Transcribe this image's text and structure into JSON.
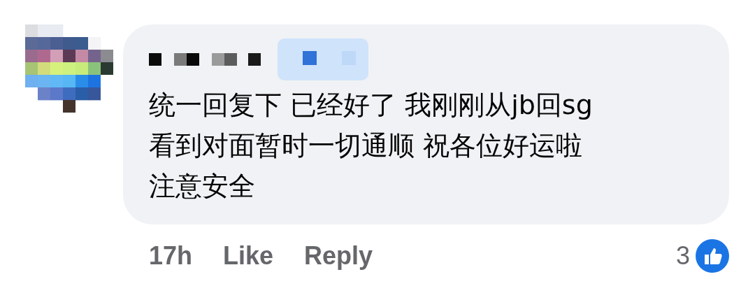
{
  "comment": {
    "lines": [
      "统一回复下 已经好了 我刚刚从jb回sg",
      "看到对面暂时一切通顺 祝各位好运啦",
      "注意安全"
    ]
  },
  "time": "17h",
  "actions": [
    "Like",
    "Reply"
  ],
  "reactions": {
    "count": "3"
  }
}
